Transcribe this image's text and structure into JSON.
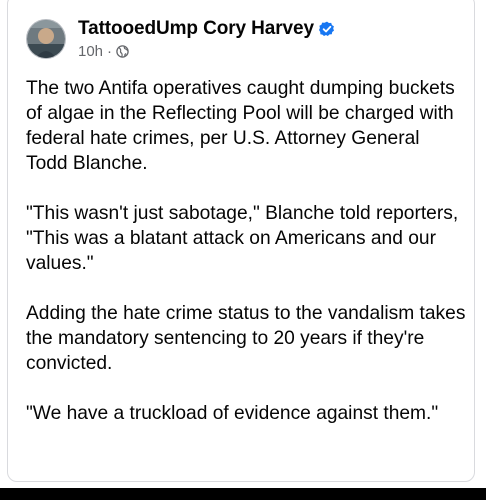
{
  "post": {
    "author": "TattooedUmp Cory Harvey",
    "time": "10h",
    "separator": "·",
    "audience_icon": "globe-icon",
    "verified_icon": "verified-badge-icon",
    "paragraphs": [
      "The two Antifa operatives caught dumping buckets of algae in the Reflecting Pool will be charged with federal hate crimes, per U.S. Attorney General Todd Blanche.",
      "\"This wasn't just sabotage,\" Blanche told reporters, \"This was a blatant attack on Americans and our values.\"",
      "Adding the hate crime status to the vandalism takes the mandatory sentencing to 20 years if they're convicted.",
      "\"We have a truckload of evidence against them.\""
    ]
  },
  "colors": {
    "verified_blue": "#1877f2",
    "meta_gray": "#65676b",
    "text": "#050505"
  }
}
